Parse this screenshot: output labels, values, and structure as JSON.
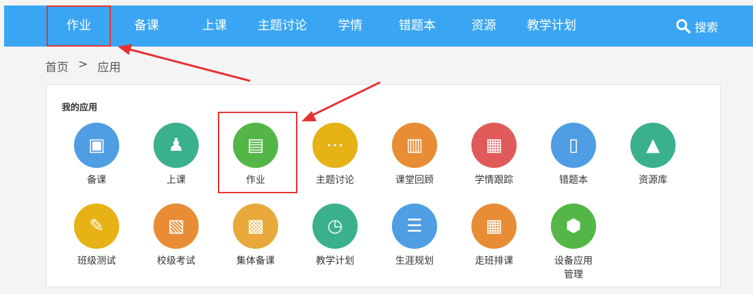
{
  "nav": {
    "items": [
      {
        "label": "作业"
      },
      {
        "label": "备课"
      },
      {
        "label": "上课"
      },
      {
        "label": "主题讨论"
      },
      {
        "label": "学情"
      },
      {
        "label": "错题本"
      },
      {
        "label": "资源"
      },
      {
        "label": "教学计划"
      }
    ],
    "search_label": "搜索"
  },
  "breadcrumb": {
    "home": "首页",
    "separator": ">",
    "current": "应用"
  },
  "section": {
    "title": "我的应用"
  },
  "apps": [
    {
      "label": "备课",
      "color": "#4f9de3",
      "icon": "lesson-prep-icon"
    },
    {
      "label": "上课",
      "color": "#3bb08f",
      "icon": "teaching-icon"
    },
    {
      "label": "作业",
      "color": "#54b647",
      "icon": "homework-icon"
    },
    {
      "label": "主题讨论",
      "color": "#e6b216",
      "icon": "discussion-icon"
    },
    {
      "label": "课堂回顾",
      "color": "#e88c35",
      "icon": "class-review-icon"
    },
    {
      "label": "学情跟踪",
      "color": "#e05a5a",
      "icon": "learning-tracking-icon"
    },
    {
      "label": "错题本",
      "color": "#4f9de3",
      "icon": "error-book-icon"
    },
    {
      "label": "资源库",
      "color": "#3bb08f",
      "icon": "resource-library-icon"
    },
    {
      "label": "班级测试",
      "color": "#e6b216",
      "icon": "class-test-icon"
    },
    {
      "label": "校级考试",
      "color": "#e88c35",
      "icon": "school-exam-icon"
    },
    {
      "label": "集体备课",
      "color": "#e8a93a",
      "icon": "group-prep-icon"
    },
    {
      "label": "教学计划",
      "color": "#3bb08f",
      "icon": "teaching-plan-icon"
    },
    {
      "label": "生涯规划",
      "color": "#4f9de3",
      "icon": "career-plan-icon"
    },
    {
      "label": "走班排课",
      "color": "#e88c35",
      "icon": "class-schedule-icon"
    },
    {
      "label": "设备应用\n管理",
      "color": "#54b647",
      "icon": "device-management-icon"
    }
  ]
}
